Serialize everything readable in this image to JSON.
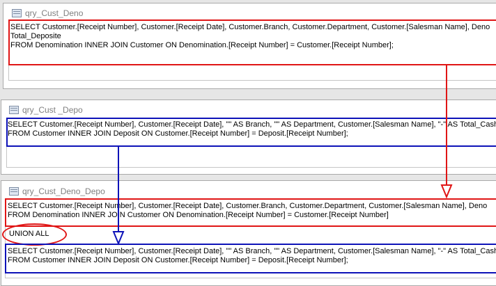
{
  "windows": [
    {
      "title": "qry_Cust_Deno",
      "sql": [
        "SELECT Customer.[Receipt Number], Customer.[Receipt Date], Customer.Branch, Customer.Department, Customer.[Salesman Name], Deno",
        "Total_Deposite",
        "FROM Denomination INNER JOIN Customer ON Denomination.[Receipt Number] = Customer.[Receipt Number];"
      ]
    },
    {
      "title": "qry_Cust _Depo",
      "sql": [
        "SELECT Customer.[Receipt Number], Customer.[Receipt Date], \"\" AS Branch, \"\" AS Department, Customer.[Salesman Name], \"-\" AS Total_Cash",
        "FROM Customer INNER JOIN Deposit ON Customer.[Receipt Number] = Deposit.[Receipt Number];"
      ]
    },
    {
      "title": "qry_Cust_Deno_Depo",
      "sql_part1": [
        "SELECT Customer.[Receipt Number], Customer.[Receipt Date], Customer.Branch, Customer.Department, Customer.[Salesman Name], Deno",
        "FROM Denomination INNER JOIN Customer ON Denomination.[Receipt Number] = Customer.[Receipt Number]"
      ],
      "union": "UNION ALL",
      "sql_part2": [
        "SELECT Customer.[Receipt Number], Customer.[Receipt Date], \"\" AS Branch, \"\" AS Department, Customer.[Salesman Name], \"-\" AS Total_Cash",
        "FROM Customer INNER JOIN Deposit ON Customer.[Receipt Number] = Deposit.[Receipt Number];"
      ]
    }
  ],
  "colors": {
    "annotation_red": "#e01515",
    "annotation_blue": "#0d12b8"
  }
}
